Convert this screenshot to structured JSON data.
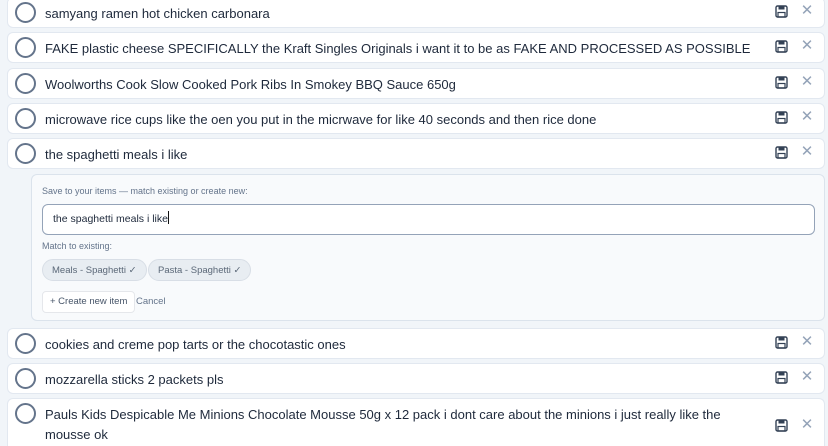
{
  "items": [
    {
      "text": "samyang ramen hot chicken carbonara"
    },
    {
      "text": "FAKE plastic cheese SPECIFICALLY the Kraft Singles Originals i want it to be as FAKE AND PROCESSED AS POSSIBLE"
    },
    {
      "text": "Woolworths Cook Slow Cooked Pork Ribs In Smokey BBQ Sauce 650g"
    },
    {
      "text": "microwave rice cups like the oen you put in the micrwave for like 40 seconds and then rice done"
    },
    {
      "text": "the spaghetti meals i like"
    },
    {
      "text": "cookies and creme pop tarts or the chocotastic ones"
    },
    {
      "text": "mozzarella sticks 2 packets pls"
    },
    {
      "text": "Pauls Kids Despicable Me Minions Chocolate Mousse 50g x 12 pack i dont care about the minions i just really like the mousse ok"
    }
  ],
  "panel": {
    "save_label": "Save to your items — match existing or create new:",
    "input_value": "the spaghetti meals i like",
    "match_label": "Match to existing:",
    "matches": [
      "Meals - Spaghetti ✓",
      "Pasta - Spaghetti ✓"
    ],
    "create_label": "+ Create new item",
    "cancel_label": "Cancel"
  },
  "icons": {
    "save": "save-icon",
    "close": "close-icon",
    "check": "checkbox-circle"
  },
  "colors": {
    "background": "#f1f5f9",
    "row": "#ffffff",
    "border": "#e2e8f0",
    "muted": "#64748b"
  }
}
